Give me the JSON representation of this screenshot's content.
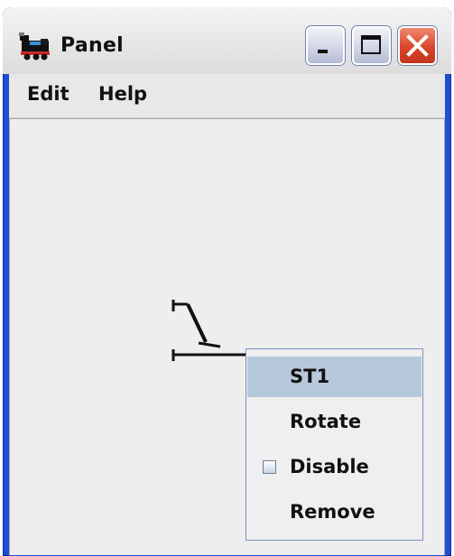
{
  "window": {
    "title": "Panel",
    "icon": "train-engine-icon",
    "controls": [
      "minimize-icon",
      "maximize-icon",
      "close-icon"
    ],
    "accent_color": "#1d4fd2"
  },
  "menubar": {
    "items": [
      {
        "label": "Edit"
      },
      {
        "label": "Help"
      }
    ]
  },
  "context_menu": {
    "items": [
      {
        "label": "ST1",
        "selected": true
      },
      {
        "label": "Rotate"
      },
      {
        "label": "Disable",
        "checkbox": true,
        "checked": false
      },
      {
        "label": "Remove"
      }
    ],
    "highlight_color": "#b8c8dc"
  },
  "panel": {
    "turnout_icon": "turnout-icon"
  }
}
